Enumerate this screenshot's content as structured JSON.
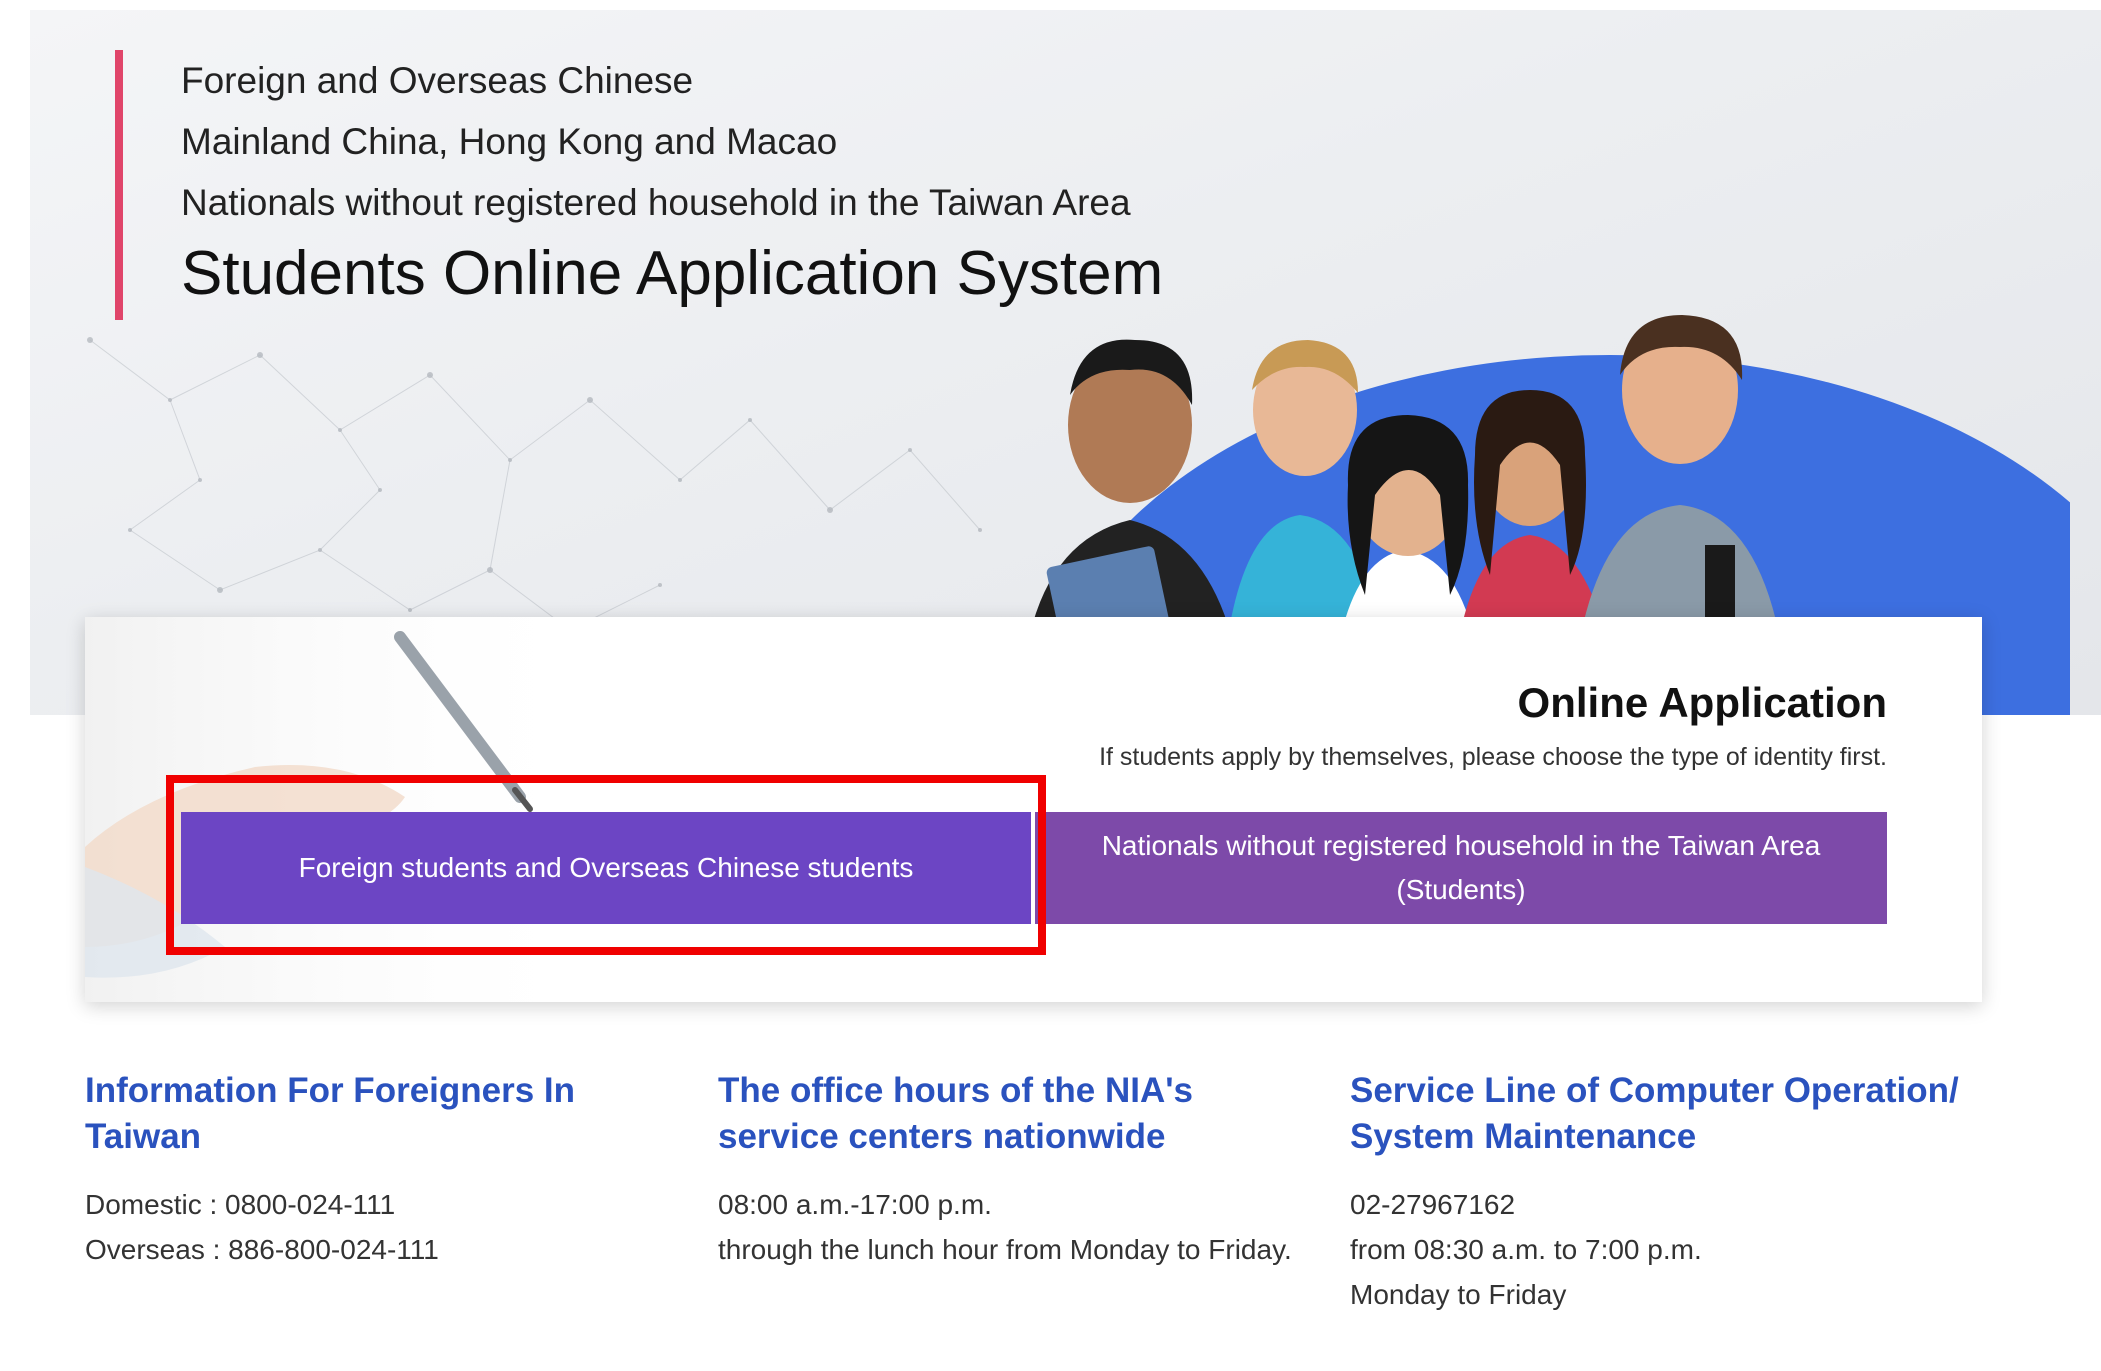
{
  "hero": {
    "subtitle_lines": [
      "Foreign and Overseas Chinese",
      "Mainland China, Hong Kong and Macao",
      "Nationals without registered household in the Taiwan Area"
    ],
    "title": "Students Online Application System",
    "accent_color": "#e0456a"
  },
  "application": {
    "title": "Online Application",
    "subtitle": "If students apply by themselves, please choose the type of identity first.",
    "buttons": {
      "foreign": "Foreign students and Overseas Chinese students",
      "nationals": "Nationals without registered household in the Taiwan Area (Students)"
    },
    "colors": {
      "foreign": "#6c45c4",
      "nationals": "#7d4aa9",
      "highlight": "#f00000"
    }
  },
  "info": [
    {
      "title": "Information For Foreigners In Taiwan",
      "lines": [
        "Domestic : 0800-024-111",
        "Overseas : 886-800-024-111"
      ]
    },
    {
      "title": "The office hours of the NIA's service centers nationwide",
      "lines": [
        "08:00 a.m.-17:00 p.m.",
        "through the lunch hour from Monday to Friday."
      ]
    },
    {
      "title": "Service Line of Computer Operation/ System Maintenance",
      "lines": [
        "02-27967162",
        "from 08:30 a.m. to 7:00 p.m.",
        "Monday to Friday"
      ]
    }
  ],
  "link_color": "#2a52be"
}
